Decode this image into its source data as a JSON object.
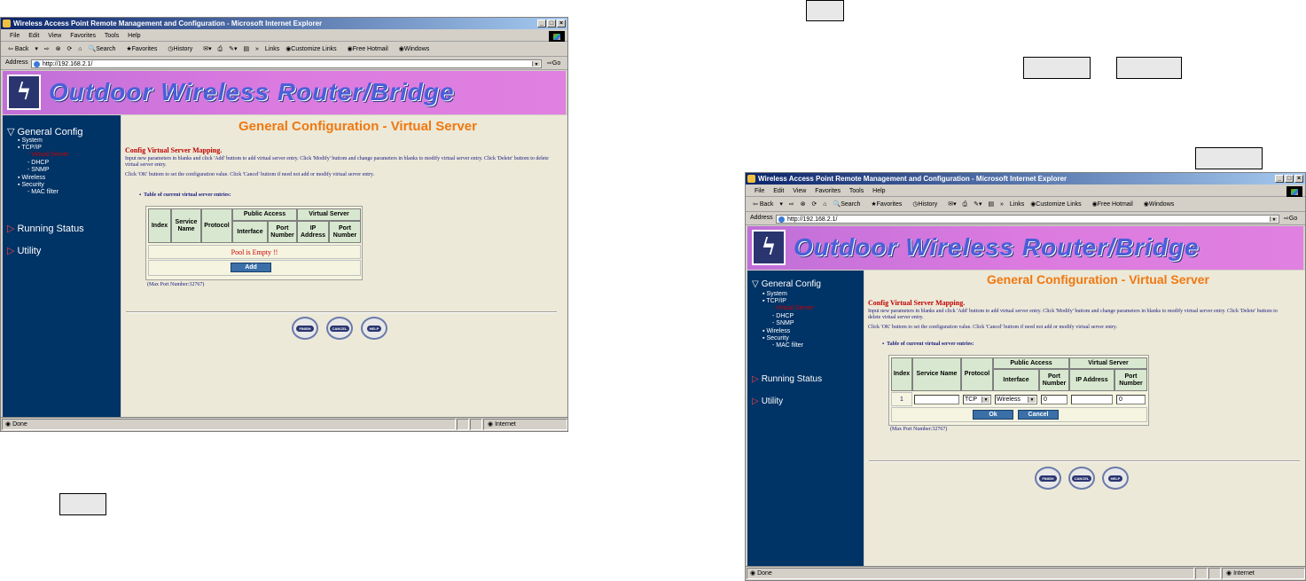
{
  "browser": {
    "title": "Wireless Access Point Remote Management and Configuration - Microsoft Internet Explorer",
    "menu": [
      "File",
      "Edit",
      "View",
      "Favorites",
      "Tools",
      "Help"
    ],
    "toolbar": {
      "back": "Back",
      "search": "Search",
      "favorites": "Favorites",
      "history": "History",
      "links_label": "Links",
      "links": [
        "Customize Links",
        "Free Hotmail",
        "Windows"
      ]
    },
    "address_label": "Address",
    "url": "http://192.168.2.1/",
    "go": "Go",
    "status_done": "Done",
    "status_zone": "Internet"
  },
  "banner": {
    "title": "Outdoor Wireless Router/Bridge"
  },
  "nav": {
    "general_config": "General Config",
    "system": "System",
    "tcpip": "TCP/IP",
    "virtual_server": "- Virtual Server",
    "dhcp": "- DHCP",
    "snmp": "- SNMP",
    "wireless": "Wireless",
    "security": "Security",
    "mac_filter": "- MAC filter",
    "running_status": "Running Status",
    "utility": "Utility"
  },
  "page": {
    "title": "General Configuration - Virtual Server",
    "heading": "Config Virtual Server Mapping.",
    "instructions_1": "Input new parameters in blanks and click 'Add' buttom to add virtual server entry. Click 'Modify' buttom and change parameters in blanks to modify virtual server entry. Click 'Delete' buttom to delete virtual server entry.",
    "instructions_2": "Click 'OK' buttom to set the configuration value. Click 'Cancel' buttom if need not add or modify virtual server entry.",
    "table_caption": "Table of current virtual server entries:",
    "col_index": "Index",
    "col_service_name": "Service Name",
    "col_protocol": "Protocol",
    "group_public": "Public Access",
    "group_virtual": "Virtual Server",
    "col_interface": "Interface",
    "col_port_number": "Port Number",
    "col_ip_address": "IP Address",
    "pool_empty": "Pool is Empty !!",
    "add_button": "Add",
    "ok_button": "Ok",
    "cancel_button": "Cancel",
    "max_port_note": "(Max Port Number:32767)",
    "finish_label": "FINISH",
    "cancel_label": "CANCEL",
    "help_label": "HELP"
  },
  "entry_row": {
    "index": "1",
    "service_name": "",
    "protocol": "TCP",
    "interface": "Wireless",
    "public_port": "0",
    "ip_address": "",
    "virtual_port": "0"
  }
}
